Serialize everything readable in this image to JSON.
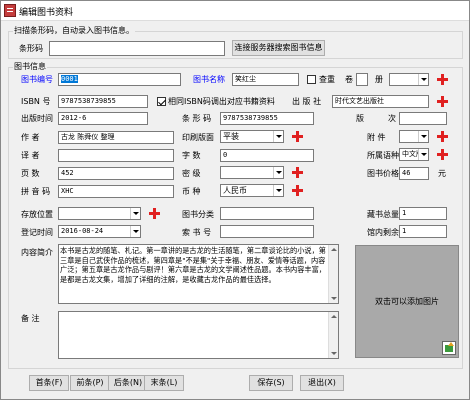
{
  "window": {
    "title": "编辑图书资料"
  },
  "scan_group": {
    "title": "扫描条形码，自动录入图书信息。",
    "barcode_label": "条形码",
    "barcode_value": "",
    "search_button": "连接服务器搜索图书信息"
  },
  "info_group": {
    "title": "图书信息"
  },
  "fields": {
    "book_no_label": "图书编号",
    "book_no_value": "0001",
    "book_name_label": "图书名称",
    "book_name_value": "笑红尘",
    "check_dup_label": "查重",
    "volume_label": "卷",
    "volume_value": "",
    "copies_label": "册",
    "copies_value": "",
    "isbn_label": "ISBN 号",
    "isbn_value": "9787538739855",
    "same_as_isbn_label": "相同ISBN码调出对应书籍资料",
    "publisher_label": "出 版 社",
    "publisher_value": "时代文艺出版社",
    "pub_date_label": "出版时间",
    "pub_date_value": "2012-6",
    "barcode_label": "条 形 码",
    "barcode_value": "9787538739855",
    "edition_label": "版",
    "edition_label2": "次",
    "edition_value": "",
    "author_label": "作    者",
    "author_value": "古龙 陈舜仪 整理",
    "binding_label": "印刷版面",
    "binding_value": "平装",
    "attachment_label": "附    件",
    "attachment_value": "",
    "translator_label": "译    者",
    "translator_value": "",
    "word_count_label": "字    数",
    "word_count_value": "0",
    "language_label": "所属语种",
    "language_value": "中文版",
    "pages_label": "页    数",
    "pages_value": "452",
    "security_label": "密    级",
    "security_value": "",
    "price_label": "图书价格",
    "price_value": "46",
    "price_unit": "元",
    "pinyin_label": "拼 音 码",
    "pinyin_value": "XHC",
    "currency_label": "币    种",
    "currency_value": "人民币",
    "location_label": "存放位置",
    "location_value": "",
    "category_label": "图书分类",
    "category_value": "",
    "total_label": "藏书总量",
    "total_value": "1",
    "reg_date_label": "登记时间",
    "reg_date_value": "2016-08-24",
    "call_no_label": "索 书 号",
    "call_no_value": "",
    "remaining_label": "馆内剩余",
    "remaining_value": "1",
    "summary_label": "内容简介",
    "summary_value": "本书是古龙的随笔、札记。第一章讲的是古龙的生活随笔，第二章谈论比的小说，第三章是自己武侠作品的梳述，第四章是\"不是集\"关于幸福、朋友、爱情等话题，内容广泛；第五章是古龙作品与剧评！第六章是古龙的文学阐述性品题。本书内容丰富，是都是古龙文集，增加了详细的注解，是收藏古龙作品的最佳选择。",
    "notes_label": "备    注",
    "notes_value": "",
    "photo_hint": "双击可以添加图片"
  },
  "buttons": {
    "first": "首条(F)",
    "prev": "前条(P)",
    "next": "后条(N)",
    "last": "末条(L)",
    "save": "保存(S)",
    "exit": "退出(X)"
  }
}
